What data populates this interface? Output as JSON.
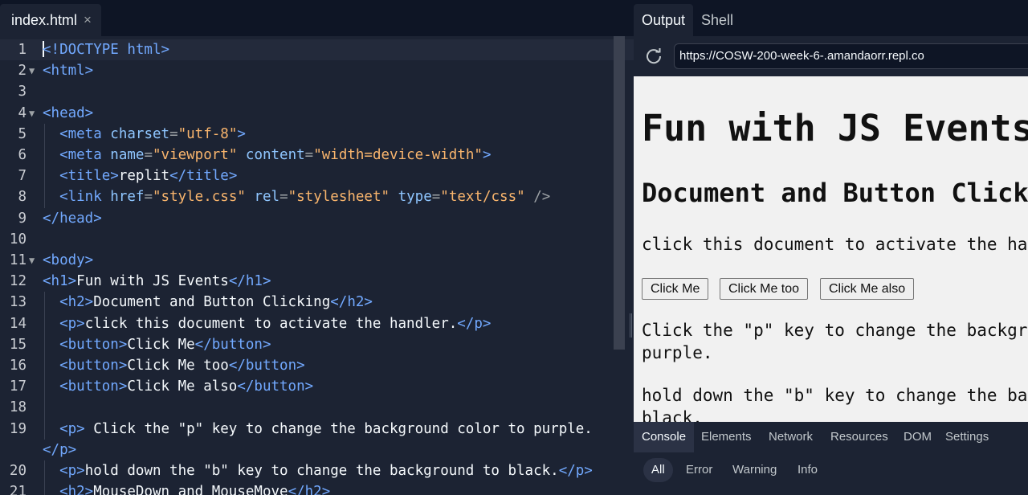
{
  "editor": {
    "tab_label": "index.html",
    "close_glyph": "×",
    "lines": [
      {
        "n": "1",
        "fold": "",
        "cur": true,
        "guide": false,
        "tokens": [
          [
            "caret",
            ""
          ],
          [
            "t",
            "<!DOCTYPE html>"
          ]
        ]
      },
      {
        "n": "2",
        "fold": "▼",
        "guide": false,
        "tokens": [
          [
            "t",
            "<html>"
          ]
        ]
      },
      {
        "n": "3",
        "fold": "",
        "guide": false,
        "tokens": []
      },
      {
        "n": "4",
        "fold": "▼",
        "guide": false,
        "tokens": [
          [
            "t",
            "<head>"
          ]
        ]
      },
      {
        "n": "5",
        "fold": "",
        "guide": true,
        "tokens": [
          [
            "w",
            "  "
          ],
          [
            "t",
            "<meta "
          ],
          [
            "a",
            "charset"
          ],
          [
            "p",
            "="
          ],
          [
            "s",
            "\"utf-8\""
          ],
          [
            "t",
            ">"
          ]
        ]
      },
      {
        "n": "6",
        "fold": "",
        "guide": true,
        "tokens": [
          [
            "w",
            "  "
          ],
          [
            "t",
            "<meta "
          ],
          [
            "a",
            "name"
          ],
          [
            "p",
            "="
          ],
          [
            "s",
            "\"viewport\""
          ],
          [
            "w",
            " "
          ],
          [
            "a",
            "content"
          ],
          [
            "p",
            "="
          ],
          [
            "s",
            "\"width=device-width\""
          ],
          [
            "t",
            ">"
          ]
        ]
      },
      {
        "n": "7",
        "fold": "",
        "guide": true,
        "tokens": [
          [
            "w",
            "  "
          ],
          [
            "t",
            "<title>"
          ],
          [
            "w",
            "replit"
          ],
          [
            "t",
            "</title>"
          ]
        ]
      },
      {
        "n": "8",
        "fold": "",
        "guide": true,
        "tokens": [
          [
            "w",
            "  "
          ],
          [
            "t",
            "<link "
          ],
          [
            "a",
            "href"
          ],
          [
            "p",
            "="
          ],
          [
            "s",
            "\"style.css\""
          ],
          [
            "w",
            " "
          ],
          [
            "a",
            "rel"
          ],
          [
            "p",
            "="
          ],
          [
            "s",
            "\"stylesheet\""
          ],
          [
            "w",
            " "
          ],
          [
            "a",
            "type"
          ],
          [
            "p",
            "="
          ],
          [
            "s",
            "\"text/css\""
          ],
          [
            "w",
            " "
          ],
          [
            "p",
            "/>"
          ]
        ]
      },
      {
        "n": "9",
        "fold": "",
        "guide": false,
        "tokens": [
          [
            "t",
            "</head>"
          ]
        ]
      },
      {
        "n": "10",
        "fold": "",
        "guide": false,
        "tokens": []
      },
      {
        "n": "11",
        "fold": "▼",
        "guide": false,
        "tokens": [
          [
            "t",
            "<body>"
          ]
        ]
      },
      {
        "n": "12",
        "fold": "",
        "guide": false,
        "tokens": [
          [
            "t",
            "<h1>"
          ],
          [
            "w",
            "Fun with JS Events"
          ],
          [
            "t",
            "</h1>"
          ]
        ]
      },
      {
        "n": "13",
        "fold": "",
        "guide": true,
        "tokens": [
          [
            "w",
            "  "
          ],
          [
            "t",
            "<h2>"
          ],
          [
            "w",
            "Document and Button Clicking"
          ],
          [
            "t",
            "</h2>"
          ]
        ]
      },
      {
        "n": "14",
        "fold": "",
        "guide": true,
        "tokens": [
          [
            "w",
            "  "
          ],
          [
            "t",
            "<p>"
          ],
          [
            "w",
            "click this document to activate the handler."
          ],
          [
            "t",
            "</p>"
          ]
        ]
      },
      {
        "n": "15",
        "fold": "",
        "guide": true,
        "tokens": [
          [
            "w",
            "  "
          ],
          [
            "t",
            "<button>"
          ],
          [
            "w",
            "Click Me"
          ],
          [
            "t",
            "</button>"
          ]
        ]
      },
      {
        "n": "16",
        "fold": "",
        "guide": true,
        "tokens": [
          [
            "w",
            "  "
          ],
          [
            "t",
            "<button>"
          ],
          [
            "w",
            "Click Me too"
          ],
          [
            "t",
            "</button>"
          ]
        ]
      },
      {
        "n": "17",
        "fold": "",
        "guide": true,
        "tokens": [
          [
            "w",
            "  "
          ],
          [
            "t",
            "<button>"
          ],
          [
            "w",
            "Click Me also"
          ],
          [
            "t",
            "</button>"
          ]
        ]
      },
      {
        "n": "18",
        "fold": "",
        "guide": true,
        "tokens": []
      },
      {
        "n": "19",
        "fold": "",
        "guide": true,
        "tokens": [
          [
            "w",
            "  "
          ],
          [
            "t",
            "<p>"
          ],
          [
            "w",
            " Click the \"p\" key to change the background color to purple."
          ]
        ]
      },
      {
        "n": "",
        "fold": "",
        "guide": false,
        "tokens": [
          [
            "t",
            "</p>"
          ]
        ]
      },
      {
        "n": "20",
        "fold": "",
        "guide": true,
        "tokens": [
          [
            "w",
            "  "
          ],
          [
            "t",
            "<p>"
          ],
          [
            "w",
            "hold down the \"b\" key to change the background to black."
          ],
          [
            "t",
            "</p>"
          ]
        ]
      },
      {
        "n": "21",
        "fold": "",
        "guide": true,
        "tokens": [
          [
            "w",
            "  "
          ],
          [
            "t",
            "<h2>"
          ],
          [
            "w",
            "MouseDown and MouseMove"
          ],
          [
            "t",
            "</h2>"
          ]
        ]
      }
    ]
  },
  "preview": {
    "tabs": {
      "output": "Output",
      "shell": "Shell"
    },
    "url": "https://COSW-200-week-6-.amandaorr.repl.co",
    "h1": "Fun with JS Events",
    "h2": "Document and Button Clicking",
    "p1": "click this document to activate the handler.",
    "buttons": [
      "Click Me",
      "Click Me too",
      "Click Me also"
    ],
    "p2_line1": "Click the \"p\" key to change the background color to",
    "p2_line2": "purple.",
    "p3_line1": "hold down the \"b\" key to change the background to",
    "p3_line2": "black."
  },
  "devtools": {
    "tabs": [
      "Console",
      "Elements",
      "Network",
      "Resources",
      "DOM",
      "Settings"
    ],
    "filters": [
      "All",
      "Error",
      "Warning",
      "Info"
    ]
  }
}
